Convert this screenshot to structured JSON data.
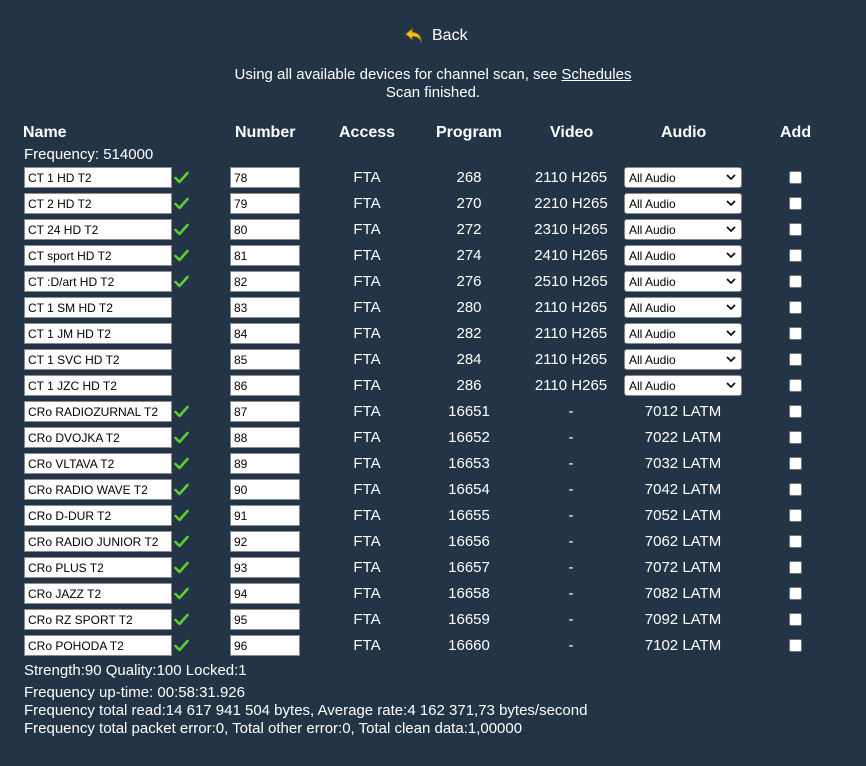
{
  "back_label": "Back",
  "info_text": "Using all available devices for channel scan, see",
  "schedules_link": "Schedules",
  "scan_status": "Scan finished.",
  "headers": [
    "Name",
    "Number",
    "Access",
    "Program",
    "Video",
    "Audio",
    "Add"
  ],
  "frequency_label": "Frequency: 514000",
  "audio_option": "All Audio",
  "channels": [
    {
      "name": "CT 1 HD T2",
      "checked": true,
      "number": "78",
      "access": "FTA",
      "program": "268",
      "video": "2110 H265",
      "audio": null
    },
    {
      "name": "CT 2 HD T2",
      "checked": true,
      "number": "79",
      "access": "FTA",
      "program": "270",
      "video": "2210 H265",
      "audio": null
    },
    {
      "name": "CT 24 HD T2",
      "checked": true,
      "number": "80",
      "access": "FTA",
      "program": "272",
      "video": "2310 H265",
      "audio": null
    },
    {
      "name": "CT sport HD T2",
      "checked": true,
      "number": "81",
      "access": "FTA",
      "program": "274",
      "video": "2410 H265",
      "audio": null
    },
    {
      "name": "CT :D/art HD T2",
      "checked": true,
      "number": "82",
      "access": "FTA",
      "program": "276",
      "video": "2510 H265",
      "audio": null
    },
    {
      "name": "CT 1 SM HD T2",
      "checked": false,
      "number": "83",
      "access": "FTA",
      "program": "280",
      "video": "2110 H265",
      "audio": null
    },
    {
      "name": "CT 1 JM HD T2",
      "checked": false,
      "number": "84",
      "access": "FTA",
      "program": "282",
      "video": "2110 H265",
      "audio": null
    },
    {
      "name": "CT 1 SVC HD T2",
      "checked": false,
      "number": "85",
      "access": "FTA",
      "program": "284",
      "video": "2110 H265",
      "audio": null
    },
    {
      "name": "CT 1 JZC HD T2",
      "checked": false,
      "number": "86",
      "access": "FTA",
      "program": "286",
      "video": "2110 H265",
      "audio": null
    },
    {
      "name": "CRo RADIOZURNAL T2",
      "checked": true,
      "number": "87",
      "access": "FTA",
      "program": "16651",
      "video": "-",
      "audio": "7012 LATM"
    },
    {
      "name": "CRo DVOJKA T2",
      "checked": true,
      "number": "88",
      "access": "FTA",
      "program": "16652",
      "video": "-",
      "audio": "7022 LATM"
    },
    {
      "name": "CRo VLTAVA T2",
      "checked": true,
      "number": "89",
      "access": "FTA",
      "program": "16653",
      "video": "-",
      "audio": "7032 LATM"
    },
    {
      "name": "CRo RADIO WAVE T2",
      "checked": true,
      "number": "90",
      "access": "FTA",
      "program": "16654",
      "video": "-",
      "audio": "7042 LATM"
    },
    {
      "name": "CRo D-DUR T2",
      "checked": true,
      "number": "91",
      "access": "FTA",
      "program": "16655",
      "video": "-",
      "audio": "7052 LATM"
    },
    {
      "name": "CRo RADIO JUNIOR T2",
      "checked": true,
      "number": "92",
      "access": "FTA",
      "program": "16656",
      "video": "-",
      "audio": "7062 LATM"
    },
    {
      "name": "CRo PLUS T2",
      "checked": true,
      "number": "93",
      "access": "FTA",
      "program": "16657",
      "video": "-",
      "audio": "7072 LATM"
    },
    {
      "name": "CRo JAZZ T2",
      "checked": true,
      "number": "94",
      "access": "FTA",
      "program": "16658",
      "video": "-",
      "audio": "7082 LATM"
    },
    {
      "name": "CRo RZ SPORT T2",
      "checked": true,
      "number": "95",
      "access": "FTA",
      "program": "16659",
      "video": "-",
      "audio": "7092 LATM"
    },
    {
      "name": "CRo POHODA T2",
      "checked": true,
      "number": "96",
      "access": "FTA",
      "program": "16660",
      "video": "-",
      "audio": "7102 LATM"
    }
  ],
  "footer": {
    "signal": "Strength:90 Quality:100 Locked:1",
    "uptime": "Frequency up-time: 00:58:31.926",
    "total_read": "Frequency total read:14 617 941 504 bytes, Average rate:4 162 371,73 bytes/second",
    "errors": "Frequency total packet error:0, Total other error:0, Total clean data:1,00000"
  },
  "colors": {
    "background": "#243447",
    "check": "#58d130",
    "text": "#ffffff"
  }
}
